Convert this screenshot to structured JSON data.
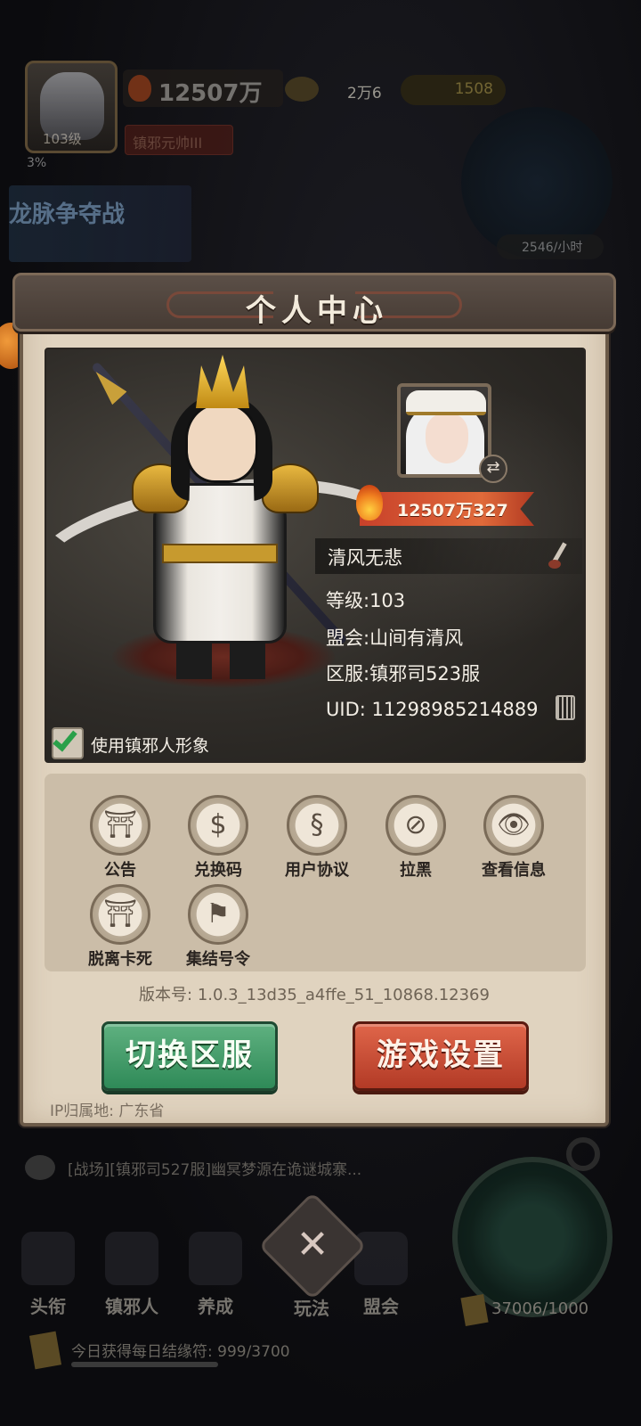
{
  "hud": {
    "level": "103级",
    "exp_percent": "3%",
    "power": "12507万",
    "gold": "2万6",
    "gems": "1508",
    "title_badge": "镇邪元帅III",
    "event_banner": "龙脉争夺战",
    "income_rate": "2546/小时",
    "chat_message": "[战场][镇邪司527服]幽冥梦源在诡谜城寨...",
    "resource_count": "37006/1000",
    "daily_quest": "今日获得每日结缘符: 999/3700"
  },
  "bottom_nav": {
    "items": [
      {
        "label": "头衔"
      },
      {
        "label": "镇邪人"
      },
      {
        "label": "养成"
      },
      {
        "label": "玩法"
      },
      {
        "label": "盟会"
      }
    ]
  },
  "dialog": {
    "title": "个人中心",
    "profile": {
      "power": "12507万327",
      "name": "清风无悲",
      "level": "等级:103",
      "guild": "盟会:山间有清风",
      "server": "区服:镇邪司523服",
      "uid": "UID: 11298985214889",
      "use_hero_skin_label": "使用镇邪人形象",
      "use_hero_skin_checked": true
    },
    "functions": [
      {
        "label": "公告",
        "icon": "gate-icon"
      },
      {
        "label": "兑换码",
        "icon": "money-bag-icon"
      },
      {
        "label": "用户协议",
        "icon": "scroll-icon"
      },
      {
        "label": "拉黑",
        "icon": "block-chat-icon"
      },
      {
        "label": "查看信息",
        "icon": "view-document-icon"
      },
      {
        "label": "脱离卡死",
        "icon": "gate-icon"
      },
      {
        "label": "集结号令",
        "icon": "flag-icon"
      }
    ],
    "version": "版本号: 1.0.3_13d35_a4ffe_51_10868.12369",
    "switch_server_label": "切换区服",
    "game_settings_label": "游戏设置",
    "ip_location": "IP归属地: 广东省"
  },
  "colors": {
    "switch_button": "#3a9a66",
    "settings_button": "#c84a32",
    "panel_bg": "#e0d3bf",
    "power_banner": "#d65a36"
  }
}
